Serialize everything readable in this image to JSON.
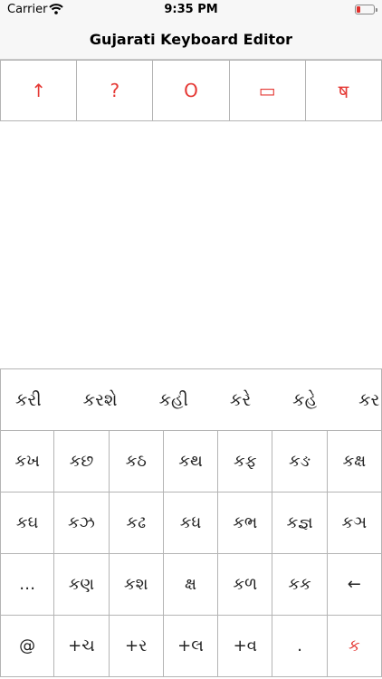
{
  "status_bar": {
    "carrier": "Carrier",
    "time": "9:35 PM",
    "battery_color": "#e0302c"
  },
  "nav": {
    "title": "Gujarati Keyboard Editor"
  },
  "toolbar": {
    "accent": "#e53935",
    "buttons": [
      {
        "label": "↑",
        "icon": "arrow-up-icon"
      },
      {
        "label": "?",
        "icon": "question-icon"
      },
      {
        "label": "O",
        "icon": "circle-icon"
      },
      {
        "label": "▭",
        "icon": "rectangle-icon"
      },
      {
        "label": "ष",
        "icon": "devanagari-sha-icon"
      }
    ]
  },
  "suggestions": [
    "કરી",
    "કરશે",
    "કહી",
    "કરે",
    "કહે",
    "કર"
  ],
  "keys": [
    [
      "કખ",
      "કછ",
      "કઠ",
      "કથ",
      "કફ",
      "કઙ",
      "કક્ષ"
    ],
    [
      "કઘ",
      "કઝ",
      "કઢ",
      "કધ",
      "કભ",
      "કજ્ઞ",
      "કઞ"
    ],
    [
      "…",
      "કણ",
      "કશ",
      "ક્ષ",
      "કળ",
      "કક",
      "←"
    ],
    [
      "@",
      "+ચ",
      "+ર",
      "+લ",
      "+વ",
      ".",
      "ક"
    ]
  ]
}
